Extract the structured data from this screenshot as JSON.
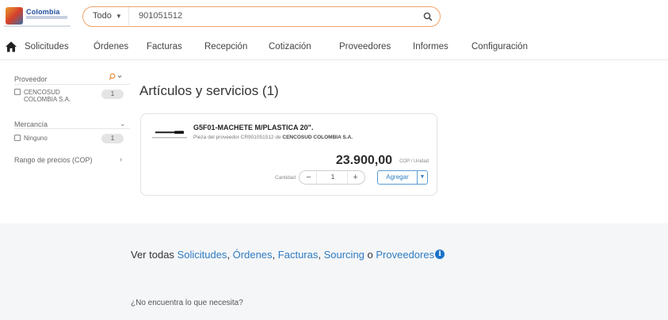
{
  "header": {
    "logo_text": "Colombia",
    "search": {
      "scope": "Todo",
      "query": "901051512"
    }
  },
  "nav": {
    "items": [
      "Solicitudes",
      "Órdenes",
      "Facturas",
      "Recepción",
      "Cotización",
      "Proveedores",
      "Informes",
      "Configuración"
    ]
  },
  "sidebar": {
    "provider_heading": "Proveedor",
    "provider_options": [
      {
        "line1": "CENCOSUD",
        "line2": "COLOMBIA S.A.",
        "count": "1"
      }
    ],
    "merchandise_heading": "Mercancía",
    "merchandise_options": [
      {
        "label": "Ninguno",
        "count": "1"
      }
    ],
    "price_range_heading": "Rango de precios (COP)"
  },
  "results": {
    "title": "Artículos y servicios (1)",
    "item": {
      "name": "G5F01-MACHETE M/PLASTICA 20\".",
      "sub_prefix": "Pieza del proveedor CR901051512 de",
      "supplier": "CENCOSUD COLOMBIA S.A.",
      "price": "23.900,00",
      "unit": "COP / Unidad",
      "qty_label": "Cantidad",
      "qty_value": "1",
      "add_label": "Agregar"
    }
  },
  "footer": {
    "view_all_prefix": "Ver todas",
    "links": [
      "Solicitudes",
      "Órdenes",
      "Facturas",
      "Sourcing",
      "Proveedores"
    ],
    "separator_or": "o",
    "info_glyph": "i",
    "not_found": "¿No encuentra lo que necesita?"
  }
}
